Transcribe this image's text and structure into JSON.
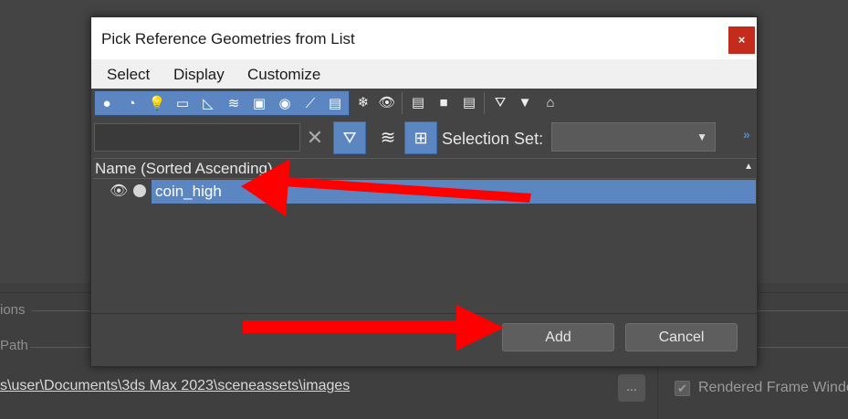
{
  "background": {
    "section_label_1": "ions",
    "section_label_2": "Path",
    "folder_path": "s\\user\\Documents\\3ds Max 2023\\sceneassets\\images",
    "browse_label": "...",
    "checkbox_label": "Rendered Frame Windo",
    "checkbox_checked": true
  },
  "dialog": {
    "title": "Pick Reference Geometries from List",
    "close_label": "×",
    "menu": [
      "Select",
      "Display",
      "Customize"
    ],
    "toolbar_icons": [
      "sphere-icon",
      "overlap-shapes-icon",
      "light-bulb-icon",
      "camera-icon",
      "ruler-icon",
      "space-warp-icon",
      "group-icon",
      "xref-icon",
      "bone-icon",
      "container-icon",
      "freeze-icon",
      "eye-icon",
      "list-icon",
      "square-icon",
      "document-icon",
      "gear-filter-icon",
      "filter-icon",
      "frame-icon"
    ],
    "search": {
      "value": "",
      "placeholder": ""
    },
    "selection_set": {
      "label": "Selection Set:",
      "value": ""
    },
    "list": {
      "header": "Name (Sorted Ascending)",
      "rows": [
        {
          "name": "coin_high",
          "visible": true,
          "selected": true
        }
      ]
    },
    "buttons": {
      "add": "Add",
      "cancel": "Cancel"
    }
  },
  "colors": {
    "accent": "#5b86c2",
    "close": "#c42b1c",
    "arrow": "#ff0000"
  }
}
